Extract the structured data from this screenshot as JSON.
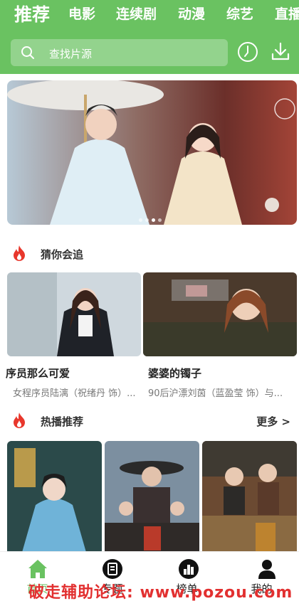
{
  "header": {
    "tabs": [
      "推荐",
      "电影",
      "连续剧",
      "动漫",
      "综艺",
      "直播"
    ],
    "search_placeholder": "查找片源"
  },
  "sections": {
    "guess": {
      "title": "猜你会追",
      "items": [
        {
          "title": "序员那么可爱",
          "desc": "女程序员陆漓（祝绪丹 饰）..."
        },
        {
          "title": "婆婆的镯子",
          "desc": "90后沪漂刘茵（蓝盈莹 饰）与..."
        }
      ]
    },
    "hot": {
      "title": "热播推荐",
      "more": "更多 >"
    }
  },
  "bottom_nav": [
    {
      "label": "首页",
      "icon": "home-icon"
    },
    {
      "label": "专题",
      "icon": "topic-icon"
    },
    {
      "label": "榜单",
      "icon": "ranking-icon"
    },
    {
      "label": "我的",
      "icon": "user-icon"
    }
  ],
  "watermark": "破走辅助论坛: www.pozou.com",
  "colors": {
    "accent": "#6ac261",
    "flame": "#e8372c"
  }
}
